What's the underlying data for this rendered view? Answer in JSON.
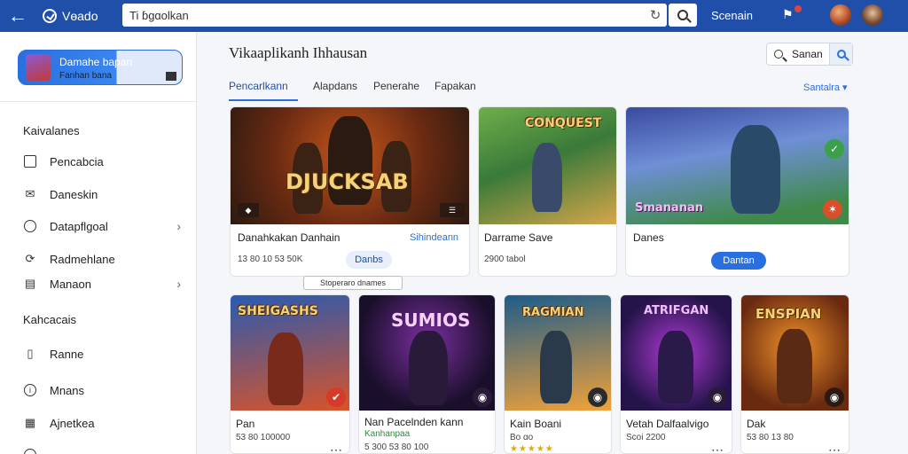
{
  "topbar": {
    "app_name": "Vɵado",
    "search_text": "Ti ɓgɑolkan",
    "link": "Scenain",
    "colors": {
      "bar": "#1f4fa8",
      "accent": "#2a6fe0"
    }
  },
  "sidebar": {
    "profile": {
      "name": "Damahe bapan",
      "subtitle": "Fanhan bana"
    },
    "section1_title": "Kaivalanes",
    "items1": [
      {
        "label": "Pencabcia",
        "icon": "box-icon"
      },
      {
        "label": "Daneskin",
        "icon": "envelope-icon"
      },
      {
        "label": "Datapflgoal",
        "icon": "clock-icon"
      },
      {
        "label": "Radmehlane",
        "icon": "refresh-icon"
      },
      {
        "label": "Manaon",
        "icon": "list-icon"
      }
    ],
    "section2_title": "Kahcacais",
    "items2": [
      {
        "label": "Ranne",
        "icon": "document-icon"
      },
      {
        "label": "Mnans",
        "icon": "info-icon"
      },
      {
        "label": "Ajnetkea",
        "icon": "grid-icon"
      }
    ]
  },
  "main": {
    "title": "Vikaaplikanh Ihhausan",
    "search_label": "Sanan",
    "tabs": [
      "Pencarlkann",
      "Alapdans",
      "Penerahe",
      "Fapakan"
    ],
    "sort_label": "Santalra ▾",
    "tooltip": "Stoperaro dnames",
    "featured": [
      {
        "art_title": "DJUCKSAB",
        "title": "Danahkakan Danhain",
        "link": "Sihindeann",
        "meta": "13 80 10 53 50K",
        "button": "Danbs",
        "bg1": "#2a1a10",
        "bg2": "#c5561c"
      },
      {
        "art_title": "CONQUEST",
        "title": "Darrame Save",
        "meta": "2900 tabol",
        "bg1": "#4f8f3a",
        "bg2": "#d6a64a"
      },
      {
        "art_title": "Smananan",
        "title": "Danes",
        "button": "Dantan",
        "bg1": "#2a3a7a",
        "bg2": "#9fc6e8"
      }
    ],
    "games": [
      {
        "art_title": "SHEIGASHS",
        "title": "Pan",
        "meta": "53 80 100000",
        "bg1": "#1b3c7a",
        "bg2": "#e7742a"
      },
      {
        "art_title": "SUMIOS",
        "title": "Nan Pacelnden kann",
        "subtitle": "Kanhanpaa",
        "meta": "5 300 53 80 100",
        "bg1": "#1a0f2a",
        "bg2": "#7a2fa0"
      },
      {
        "art_title": "RAGMIAN",
        "title": "Kain Boani",
        "meta": "Bo ɑo",
        "bg1": "#1e5c8a",
        "bg2": "#f0a23a"
      },
      {
        "art_title": "ATRIFGAN",
        "title": "Vetah Dalfaalvigo",
        "meta": "Scoi 2200",
        "bg1": "#24144a",
        "bg2": "#b03ad6"
      },
      {
        "art_title": "ENSPIAN",
        "title": "Dak",
        "meta": "53 80 13 80",
        "bg1": "#6a2a10",
        "bg2": "#f0922a"
      }
    ]
  }
}
